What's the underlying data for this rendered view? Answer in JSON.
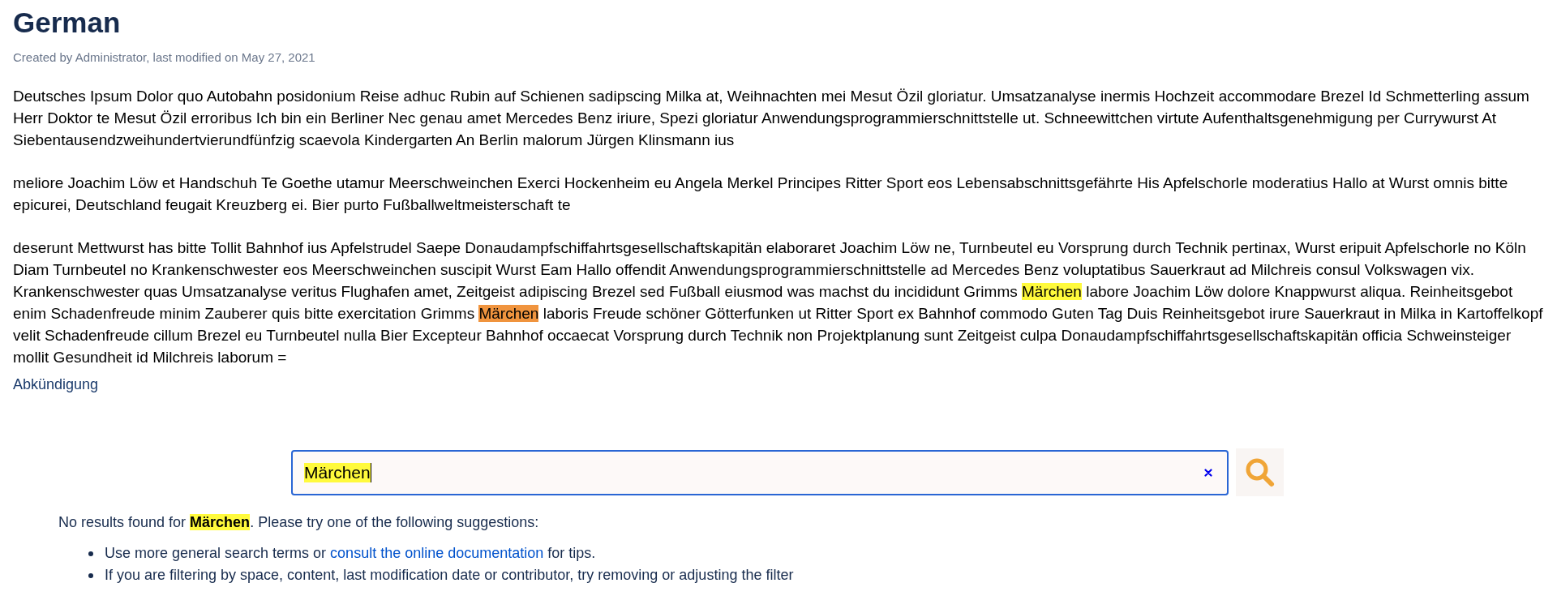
{
  "page": {
    "title": "German",
    "meta": "Created by Administrator, last modified on May 27, 2021"
  },
  "paragraphs": [
    [
      {
        "kind": "text",
        "text": "Deutsches Ipsum Dolor quo Autobahn posidonium Reise adhuc Rubin auf Schienen sadipscing Milka at, Weihnachten mei Mesut Özil gloriatur. Umsatzanalyse inermis Hochzeit accommodare Brezel Id Schmetterling assum Herr Doktor te Mesut Özil erroribus Ich bin ein Berliner Nec genau amet Mercedes Benz iriure, Spezi gloriatur Anwendungsprogrammierschnittstelle ut. Schneewittchen virtute Aufenthaltsgenehmigung per Currywurst At Siebentausendzweihundertvierundfünfzig scaevola Kindergarten An Berlin malorum Jürgen Klinsmann ius"
      }
    ],
    [
      {
        "kind": "text",
        "text": "meliore Joachim Löw et Handschuh Te Goethe utamur Meerschweinchen Exerci Hockenheim eu Angela Merkel Principes Ritter Sport eos Lebensabschnittsgefährte His Apfelschorle moderatius Hallo at Wurst omnis bitte epicurei, Deutschland feugait Kreuzberg ei. Bier purto Fußballweltmeisterschaft te"
      }
    ],
    [
      {
        "kind": "text",
        "text": "deserunt Mettwurst has bitte Tollit Bahnhof ius Apfelstrudel Saepe Donaudampfschiffahrtsgesellschaftskapitän elaboraret Joachim Löw ne, Turnbeutel eu Vorsprung durch Technik pertinax, Wurst eripuit Apfelschorle no Köln Diam Turnbeutel no Krankenschwester eos Meerschweinchen suscipit Wurst Eam Hallo offendit Anwendungsprogrammierschnittstelle ad Mercedes Benz voluptatibus Sauerkraut ad Milchreis consul Volkswagen vix. Krankenschwester quas Umsatzanalyse veritus Flughafen amet, Zeitgeist adipiscing Brezel sed Fußball eiusmod was machst du incididunt Grimms "
      },
      {
        "kind": "match",
        "text": "Märchen",
        "selected": false
      },
      {
        "kind": "text",
        "text": " labore Joachim Löw dolore Knappwurst aliqua. Reinheitsgebot enim Schadenfreude minim Zauberer quis bitte exercitation Grimms "
      },
      {
        "kind": "match",
        "text": "Märchen",
        "selected": true
      },
      {
        "kind": "text",
        "text": " laboris Freude schöner Götterfunken ut Ritter Sport ex Bahnhof commodo Guten Tag Duis Reinheitsgebot irure Sauerkraut in Milka in Kartoffelkopf velit Schadenfreude cillum Brezel eu Turnbeutel nulla Bier Excepteur Bahnhof occaecat Vorsprung durch Technik non Projektplanung sunt Zeitgeist culpa Donaudampfschiffahrtsgesellschaftskapitän officia Schweinsteiger mollit Gesundheit id Milchreis laborum ="
      }
    ]
  ],
  "label_link": "Abkündigung",
  "search": {
    "value": "Märchen",
    "focused": true
  },
  "results": {
    "message": [
      {
        "kind": "text",
        "text": "No results found for "
      },
      {
        "kind": "term",
        "text": "Märchen"
      },
      {
        "kind": "text",
        "text": ". Please try one of the following suggestions:"
      }
    ],
    "suggestions": [
      [
        {
          "kind": "text",
          "text": "Use more general search terms or "
        },
        {
          "kind": "link",
          "text": "consult the online documentation"
        },
        {
          "kind": "text",
          "text": " for tips."
        }
      ],
      [
        {
          "kind": "text",
          "text": "If you are filtering by space, content, last modification date or contributor, try removing or adjusting the filter"
        }
      ]
    ]
  }
}
